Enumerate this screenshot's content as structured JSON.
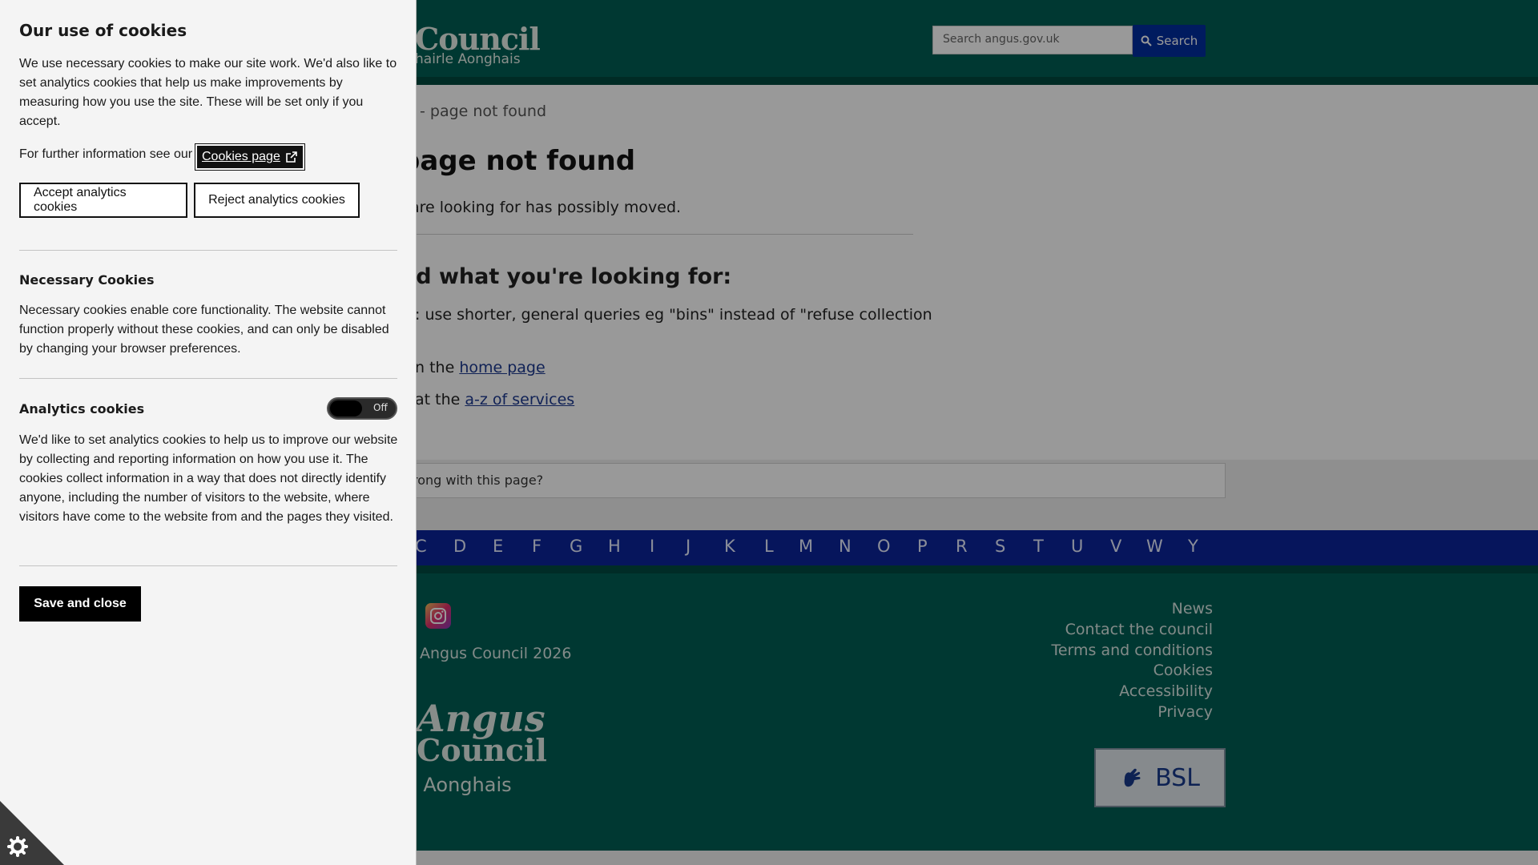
{
  "header": {
    "logo_top": "Council",
    "logo_sub": "hairle Aonghais",
    "search_placeholder": "Search angus.gov.uk",
    "search_label": "Search"
  },
  "main": {
    "breadcrumb": "- page not found",
    "heading": "page not found",
    "lead": "are looking for has possibly moved.",
    "subheading": "nd what you're looking for:",
    "tip": ": use shorter, general queries eg \"bins\" instead of \"refuse collection",
    "line1_prefix": "n the ",
    "line1_link": "home page",
    "line2_prefix": "at the ",
    "line2_link": "a-z of services"
  },
  "feedback": {
    "label": "rong with this page?"
  },
  "az": [
    "C",
    "D",
    "E",
    "F",
    "G",
    "H",
    "I",
    "J",
    "K",
    "L",
    "M",
    "N",
    "O",
    "P",
    "R",
    "S",
    "T",
    "U",
    "V",
    "W",
    "Y"
  ],
  "footer": {
    "copyright": "Angus Council 2026",
    "logo_line1": "Angus",
    "logo_line2": "Council",
    "logo_line3": "e Aonghais",
    "links": [
      "News",
      "Contact the council",
      "Terms and conditions",
      "Cookies",
      "Accessibility",
      "Privacy"
    ],
    "bsl_label": "BSL"
  },
  "cookies": {
    "title": "Our use of cookies",
    "intro": "We use necessary cookies to make our site work. We'd also like to set analytics cookies that help us make improvements by measuring how you use the site. These will be set only if you accept.",
    "further": "For further information see our",
    "cookies_link": "Cookies page",
    "accept": "Accept analytics cookies",
    "reject": "Reject analytics cookies",
    "necessary_title": "Necessary Cookies",
    "necessary_body": "Necessary cookies enable core functionality. The website cannot function properly without these cookies, and can only be disabled by changing your browser preferences.",
    "analytics_title": "Analytics cookies",
    "analytics_toggle": "Off",
    "analytics_body": "We'd like to set analytics cookies to help us to improve our website by collecting and reporting information on how you use it. The cookies collect information in a way that does not directly identify anyone, including the number of visitors to the website, where visitors have come to the website from and the pages they visited.",
    "save": "Save and close"
  },
  "colors": {
    "header_green": "#005e54",
    "az_blue": "#0a249a",
    "search_button": "#002e9e"
  }
}
